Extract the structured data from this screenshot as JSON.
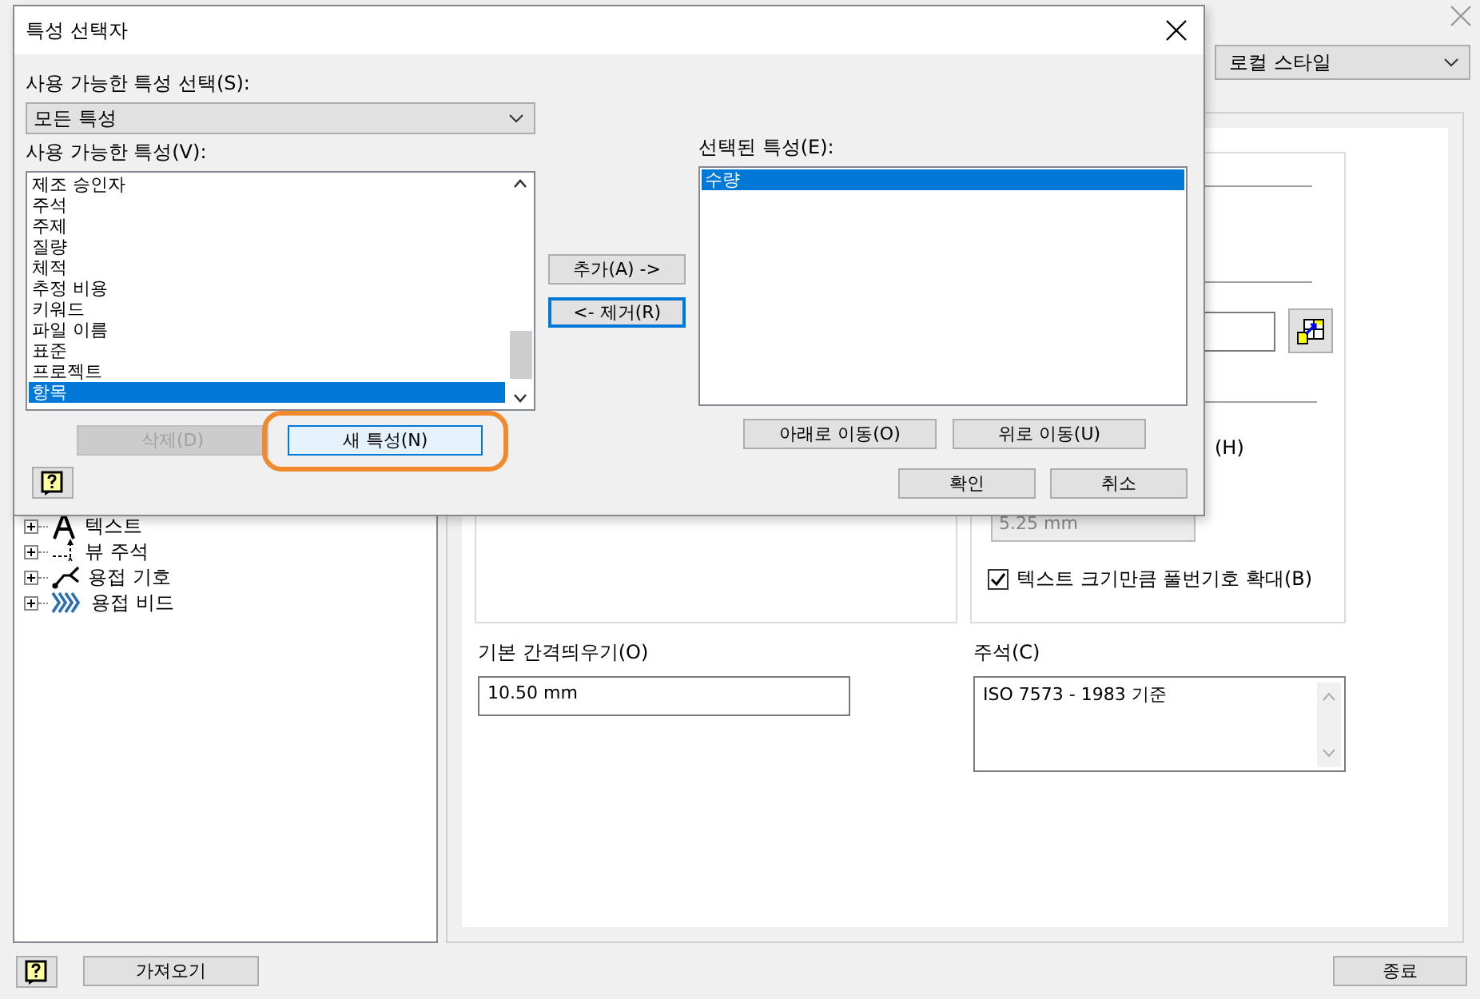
{
  "window": {
    "style_dropdown": {
      "value": "로컬 스타일"
    }
  },
  "tree": {
    "items": [
      {
        "label": "텍스트",
        "kind": "text",
        "expanded": false
      },
      {
        "label": "뷰 주석",
        "kind": "view",
        "expanded": false
      },
      {
        "label": "용접 기호",
        "kind": "weld",
        "expanded": false
      },
      {
        "label": "용접 비드",
        "kind": "bead",
        "expanded": false
      }
    ]
  },
  "details": {
    "label_tail": "(H)",
    "disabled_value": "5.25 mm",
    "scale_checkbox": {
      "label": "텍스트 크기만큼 풀번기호 확대(B)",
      "checked": true
    },
    "offset_label": "기본 간격띄우기(O)",
    "offset_value": "10.50 mm",
    "note_label": "주석(C)",
    "note_value": "ISO 7573 - 1983 기준"
  },
  "footer": {
    "import_button": "가져오기",
    "close_button": "종료"
  },
  "dialog": {
    "title": "특성 선택자",
    "category_label": "사용 가능한 특성 선택(S):",
    "category_value": "모든 특성",
    "available_label": "사용 가능한 특성(V):",
    "available_items": [
      {
        "label": "제조 승인자",
        "selected": false
      },
      {
        "label": "주석",
        "selected": false
      },
      {
        "label": "주제",
        "selected": false
      },
      {
        "label": "질량",
        "selected": false
      },
      {
        "label": "체적",
        "selected": false
      },
      {
        "label": "추정 비용",
        "selected": false
      },
      {
        "label": "키워드",
        "selected": false
      },
      {
        "label": "파일 이름",
        "selected": false
      },
      {
        "label": "표준",
        "selected": false
      },
      {
        "label": "프로젝트",
        "selected": false
      },
      {
        "label": "항목",
        "selected": true
      }
    ],
    "delete_button": {
      "label": "삭제(D)",
      "disabled": true
    },
    "new_button": {
      "label": "새 특성(N)",
      "highlighted": true
    },
    "add_button": "추가(A) ->",
    "remove_button": "<- 제거(R)",
    "selected_label": "선택된 특성(E):",
    "selected_items": [
      {
        "label": "수량",
        "selected": true
      }
    ],
    "down_button": "아래로 이동(O)",
    "up_button": "위로 이동(U)",
    "ok_button": "확인",
    "cancel_button": "취소"
  }
}
